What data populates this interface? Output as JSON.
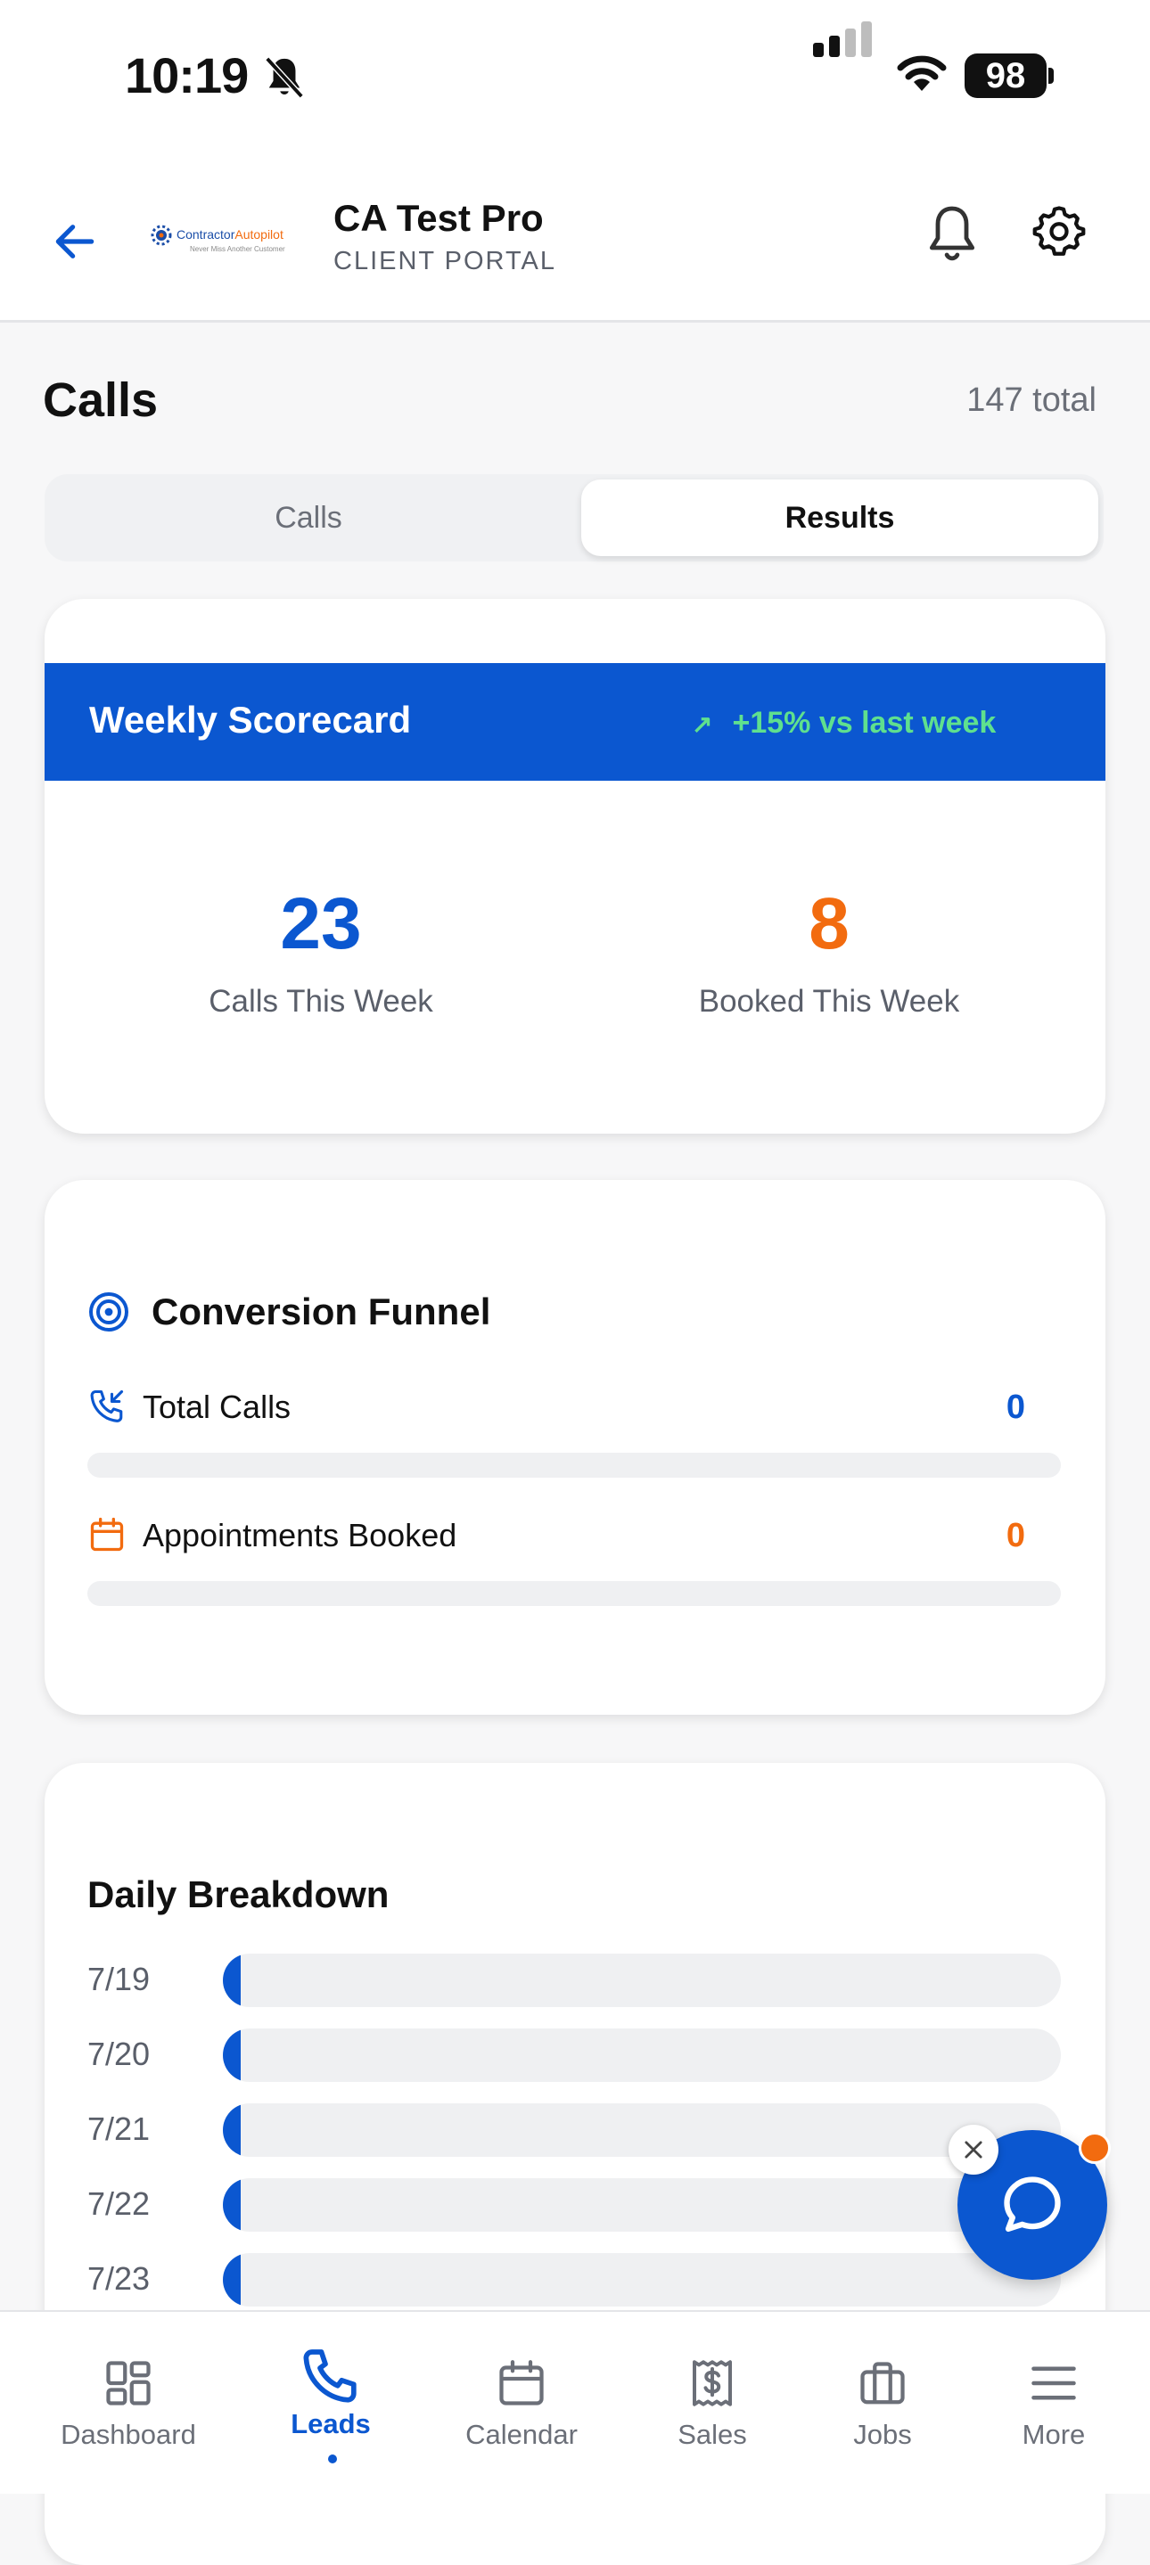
{
  "status_bar": {
    "time": "10:19",
    "battery": "98"
  },
  "header": {
    "logo_text_a": "Contractor",
    "logo_text_b": "Autopilot",
    "logo_tagline": "Never Miss Another Customer",
    "company_name": "CA Test Pro",
    "portal_label": "CLIENT PORTAL"
  },
  "page": {
    "title": "Calls",
    "total": "147 total"
  },
  "tabs": [
    {
      "label": "Calls",
      "selected": false
    },
    {
      "label": "Results",
      "selected": true
    }
  ],
  "scorecard": {
    "title": "Weekly Scorecard",
    "trend_arrow": "↗",
    "trend": "+15% vs last week",
    "calls_value": "23",
    "calls_label": "Calls This Week",
    "booked_value": "8",
    "booked_label": "Booked This Week"
  },
  "funnel": {
    "title": "Conversion Funnel",
    "total_calls_label": "Total Calls",
    "total_calls_value": "0",
    "appointments_label": "Appointments Booked",
    "appointments_value": "0"
  },
  "daily": {
    "title": "Daily Breakdown",
    "rows": [
      {
        "date": "7/19",
        "value": 0
      },
      {
        "date": "7/20",
        "value": 0
      },
      {
        "date": "7/21",
        "value": 0
      },
      {
        "date": "7/22",
        "value": 0
      },
      {
        "date": "7/23",
        "value": 0
      }
    ]
  },
  "bottom_nav": [
    {
      "label": "Dashboard",
      "icon": "dashboard-icon",
      "active": false
    },
    {
      "label": "Leads",
      "icon": "phone-icon",
      "active": true
    },
    {
      "label": "Calendar",
      "icon": "calendar-icon",
      "active": false
    },
    {
      "label": "Sales",
      "icon": "receipt-dollar-icon",
      "active": false
    },
    {
      "label": "Jobs",
      "icon": "briefcase-icon",
      "active": false
    },
    {
      "label": "More",
      "icon": "menu-icon",
      "active": false
    }
  ],
  "colors": {
    "primary": "#0b57d0",
    "accent": "#f26b0f",
    "trend_green": "#5fe08e"
  }
}
